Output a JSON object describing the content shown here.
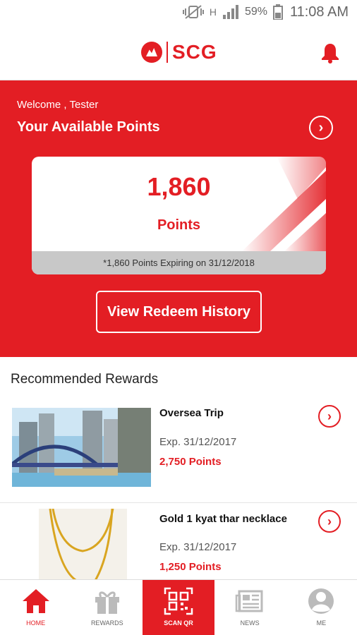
{
  "status_bar": {
    "battery_percent": "59%",
    "time": "11:08 AM",
    "network_label": "H"
  },
  "header": {
    "brand": "SCG"
  },
  "hero": {
    "welcome": "Welcome ,  Tester",
    "title": "Your Available Points",
    "points_value": "1,860",
    "points_unit": "Points",
    "expiry_note": "*1,860 Points Expiring on 31/12/2018",
    "history_button": "View Redeem History"
  },
  "rewards": {
    "section_title": "Recommended Rewards",
    "items": [
      {
        "title": "Oversea Trip",
        "expiry": "Exp. 31/12/2017",
        "points": "2,750 Points"
      },
      {
        "title": "Gold 1 kyat thar necklace",
        "expiry": "Exp. 31/12/2017",
        "points": "1,250 Points"
      }
    ]
  },
  "bottom_nav": [
    {
      "label": "HOME",
      "icon": "home-icon",
      "active": true
    },
    {
      "label": "REWARDS",
      "icon": "gift-icon",
      "active": false
    },
    {
      "label": "SCAN QR",
      "icon": "qr-code-icon",
      "active": false
    },
    {
      "label": "NEWS",
      "icon": "newspaper-icon",
      "active": false
    },
    {
      "label": "ME",
      "icon": "user-icon",
      "active": false
    }
  ],
  "colors": {
    "brand_red": "#e31e24",
    "expiry_bar": "#c8c8c8"
  }
}
